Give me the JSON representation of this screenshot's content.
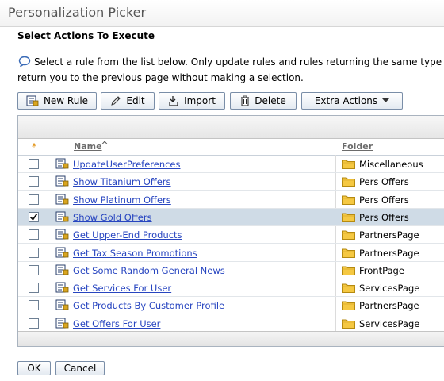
{
  "window": {
    "title": "Personalization Picker"
  },
  "page": {
    "subtitle": "Select Actions To Execute",
    "instructions_line1": "Select a rule from the list below. Only update rules and rules returning the same type of c",
    "instructions_line2": "return you to the previous page without making a selection."
  },
  "toolbar": {
    "new_rule": "New Rule",
    "edit": "Edit",
    "import": "Import",
    "delete": "Delete",
    "extra_actions": "Extra Actions"
  },
  "table": {
    "select_col": "*",
    "name_col": "Name",
    "name_sort_indicator": "^",
    "folder_col": "Folder",
    "rows": [
      {
        "name": "UpdateUserPreferences",
        "folder": "Miscellaneous",
        "checked": false
      },
      {
        "name": "Show Titanium Offers",
        "folder": "Pers Offers",
        "checked": false
      },
      {
        "name": "Show Platinum Offers",
        "folder": "Pers Offers",
        "checked": false
      },
      {
        "name": "Show Gold Offers",
        "folder": "Pers Offers",
        "checked": true
      },
      {
        "name": "Get Upper-End Products",
        "folder": "PartnersPage",
        "checked": false
      },
      {
        "name": "Get Tax Season Promotions",
        "folder": "PartnersPage",
        "checked": false
      },
      {
        "name": "Get Some Random General News",
        "folder": "FrontPage",
        "checked": false
      },
      {
        "name": "Get Services For User",
        "folder": "ServicesPage",
        "checked": false
      },
      {
        "name": "Get Products By Customer Profile",
        "folder": "PartnersPage",
        "checked": false
      },
      {
        "name": "Get Offers For User",
        "folder": "ServicesPage",
        "checked": false
      }
    ]
  },
  "footer": {
    "ok": "OK",
    "cancel": "Cancel"
  },
  "colors": {
    "link": "#2745c0",
    "selected_row": "#cfdbe6",
    "folder": "#f5c842"
  }
}
